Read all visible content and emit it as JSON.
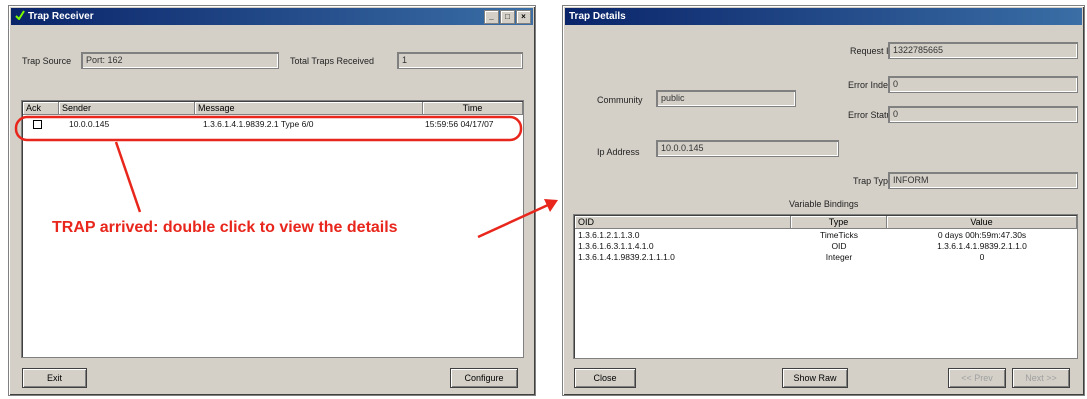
{
  "trap_receiver": {
    "title": "Trap Receiver",
    "window_buttons": {
      "minimize": "_",
      "maximize": "□",
      "close": "×"
    },
    "trap_source_label": "Trap Source",
    "trap_source_value": "Port: 162",
    "total_traps_label": "Total Traps Received",
    "total_traps_value": "1",
    "columns": [
      "Ack",
      "Sender",
      "Message",
      "Time"
    ],
    "rows": [
      {
        "ack": "",
        "sender": "10.0.0.145",
        "message": "1.3.6.1.4.1.9839.2.1  Type 6/0",
        "time": "15:59:56 04/17/07"
      }
    ],
    "exit_label": "Exit",
    "configure_label": "Configure"
  },
  "annotation": {
    "text": "TRAP arrived: double click to view the details",
    "color": "#e8261c"
  },
  "trap_details": {
    "title": "Trap Details",
    "request_id_label": "Request ID",
    "request_id_value": "1322785665",
    "error_index_label": "Error Index",
    "error_index_value": "0",
    "error_status_label": "Error Status",
    "error_status_value": "0",
    "community_label": "Community",
    "community_value": "public",
    "ip_address_label": "Ip Address",
    "ip_address_value": "10.0.0.145",
    "trap_type_label": "Trap Type",
    "trap_type_value": "INFORM",
    "bindings_label": "Variable Bindings",
    "columns": [
      "OID",
      "Type",
      "Value"
    ],
    "rows": [
      {
        "oid": "1.3.6.1.2.1.1.3.0",
        "type": "TimeTicks",
        "value": "0 days 00h:59m:47.30s"
      },
      {
        "oid": "1.3.6.1.6.3.1.1.4.1.0",
        "type": "OID",
        "value": "1.3.6.1.4.1.9839.2.1.1.0"
      },
      {
        "oid": "1.3.6.1.4.1.9839.2.1.1.1.0",
        "type": "Integer",
        "value": "0"
      }
    ],
    "close_label": "Close",
    "show_raw_label": "Show Raw",
    "prev_label": "<< Prev",
    "next_label": "Next >>"
  }
}
